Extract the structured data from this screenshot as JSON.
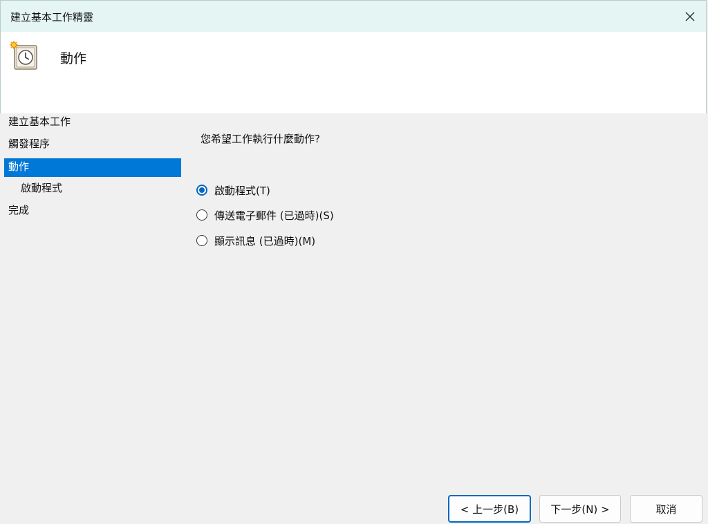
{
  "window": {
    "title": "建立基本工作精靈"
  },
  "header": {
    "title": "動作",
    "icon": "task-scheduler-clock-icon"
  },
  "sidebar": {
    "items": [
      {
        "label": "建立基本工作"
      },
      {
        "label": "觸發程序"
      },
      {
        "label": "動作"
      },
      {
        "label": "啟動程式"
      },
      {
        "label": "完成"
      }
    ],
    "selected_index": 2
  },
  "main": {
    "question": "您希望工作執行什麼動作?",
    "options": [
      {
        "label": "啟動程式(T)",
        "checked": true
      },
      {
        "label": "傳送電子郵件 (已過時)(S)",
        "checked": false
      },
      {
        "label": "顯示訊息 (已過時)(M)",
        "checked": false
      }
    ]
  },
  "buttons": {
    "back": "< 上一步(B)",
    "next": "下一步(N) >",
    "cancel": "取消"
  },
  "colors": {
    "accent": "#0078d7",
    "titlebar": "#e4f5f3"
  }
}
